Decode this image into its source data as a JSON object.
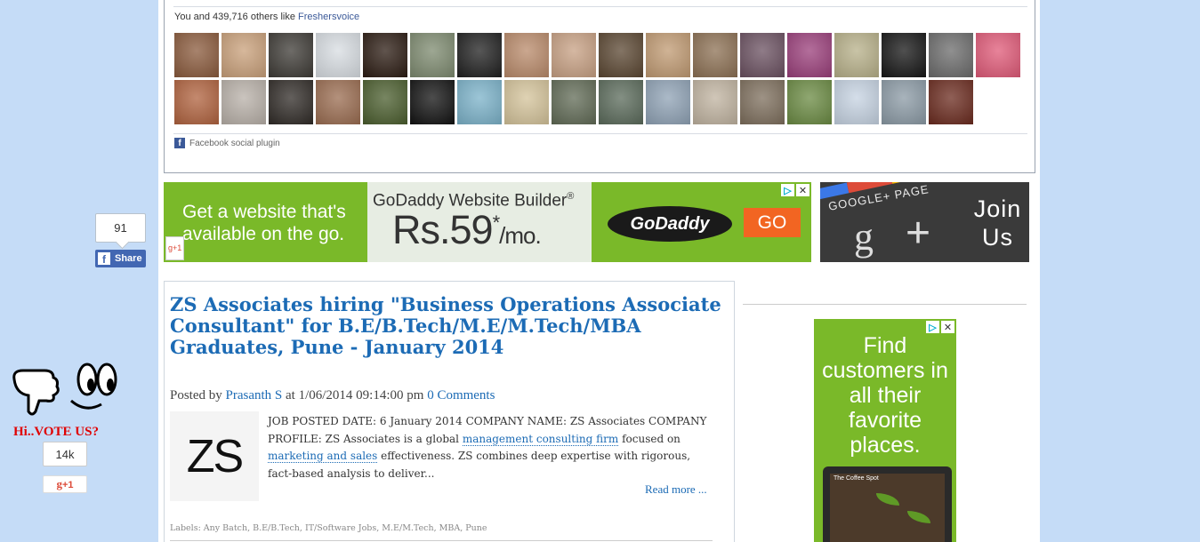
{
  "facebook_widget": {
    "like_text_prefix": "You and 439,716 others like ",
    "page_link": "Freshersvoice",
    "plugin_label": "Facebook social plugin",
    "faces_row1": [
      "#8a5a3c",
      "#c9a07a",
      "#3d3a35",
      "#d8dde2",
      "#2b1b12",
      "#7d8a6f",
      "#1f1f1f",
      "#b98a6a",
      "#c7a083",
      "#5a4631",
      "#c09a72",
      "#8c7053",
      "#6a5060",
      "#9a3e7a",
      "#b7b089",
      "#151515",
      "#6b6b6b",
      "#e05a78"
    ],
    "faces_row2": [
      "#b0623e",
      "#b8b0a8",
      "#2f2a26",
      "#9a6c50",
      "#4a5d2d",
      "#111111",
      "#7bb2c9",
      "#d4c39a",
      "#606a55",
      "#5a6a5a",
      "#8fa2b5",
      "#c0b3a0",
      "#7d6e5c",
      "#6a8a42",
      "#c6d3e2",
      "#8b9aa5",
      "#6a2a1e"
    ]
  },
  "share_widget": {
    "count": "91",
    "label": "Share"
  },
  "vote_widget": {
    "title": "Hi..VOTE US?",
    "count": "14k",
    "gplus_label": "+1"
  },
  "ad_banner": {
    "left_text": "Get a website that's available on the go.",
    "product": "GoDaddy Website Builder",
    "product_mark": "®",
    "price_main": "Rs.59",
    "price_star": "*",
    "price_unit": "/mo.",
    "brand": "GoDaddy",
    "cta": "GO",
    "gplus_small": "g+1",
    "adchoices_icon": "adchoices-icon",
    "close_glyph": "✕"
  },
  "gplus_join": {
    "page_label": "GOOGLE+ PAGE",
    "g_glyph": "g",
    "plus_glyph": "+",
    "join_text": "Join Us"
  },
  "post": {
    "title": "ZS Associates hiring \"Business Operations Associate Consultant\" for B.E/B.Tech/M.E/M.Tech/MBA Graduates, Pune - January 2014",
    "posted_by_label": "Posted by",
    "author": "Prasanth S",
    "at_label": "at",
    "datetime": "1/06/2014 09:14:00 pm",
    "comments": "0 Comments",
    "thumb_text": "ZS",
    "excerpt_part1": "JOB POSTED DATE:  6 January 2014 COMPANY NAME:  ZS Associates COMPANY PROFILE:                  ZS Associates is a global ",
    "excerpt_link1": "management consulting firm",
    "excerpt_part2": " focused on ",
    "excerpt_link2": "marketing and sales",
    "excerpt_part3": " effectiveness. ZS combines deep expertise with rigorous, fact-based analysis to deliver...",
    "read_more": "Read more ...",
    "labels": "Labels: Any Batch, B.E/B.Tech, IT/Software Jobs, M.E/M.Tech, MBA, Pune"
  },
  "sidebar_ad": {
    "text": "Find customers in all their favorite places.",
    "screen_caption": "The Coffee Spot"
  }
}
